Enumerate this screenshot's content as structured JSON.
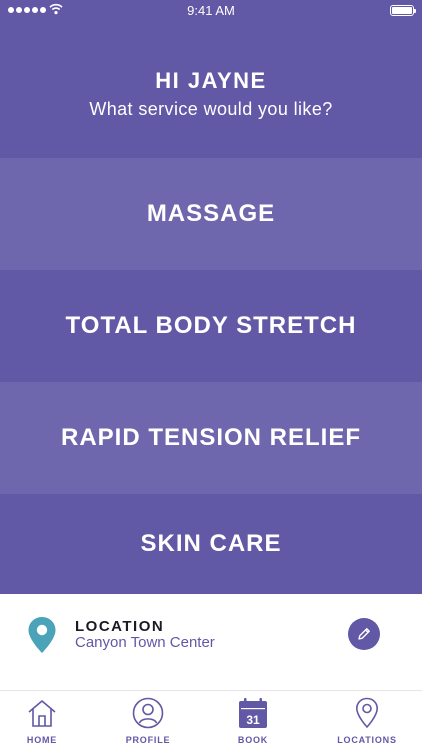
{
  "status_bar": {
    "time": "9:41 AM"
  },
  "header": {
    "greeting": "HI JAYNE",
    "prompt": "What service would you like?"
  },
  "services": [
    {
      "label": "MASSAGE"
    },
    {
      "label": "TOTAL BODY STRETCH"
    },
    {
      "label": "RAPID TENSION RELIEF"
    },
    {
      "label": "SKIN CARE"
    }
  ],
  "location": {
    "title": "LOCATION",
    "value": "Canyon Town Center",
    "icon": "map-pin-icon",
    "edit_icon": "pencil-icon"
  },
  "tabs": [
    {
      "label": "HOME",
      "icon": "home-icon"
    },
    {
      "label": "PROFILE",
      "icon": "user-icon"
    },
    {
      "label": "BOOK",
      "icon": "calendar-icon",
      "icon_text": "31"
    },
    {
      "label": "LOCATIONS",
      "icon": "location-pin-icon"
    }
  ],
  "colors": {
    "primary": "#6158a6",
    "primary_light": "#6f67ae",
    "pin": "#4aa3b8",
    "text_dark": "#1a1a24"
  }
}
